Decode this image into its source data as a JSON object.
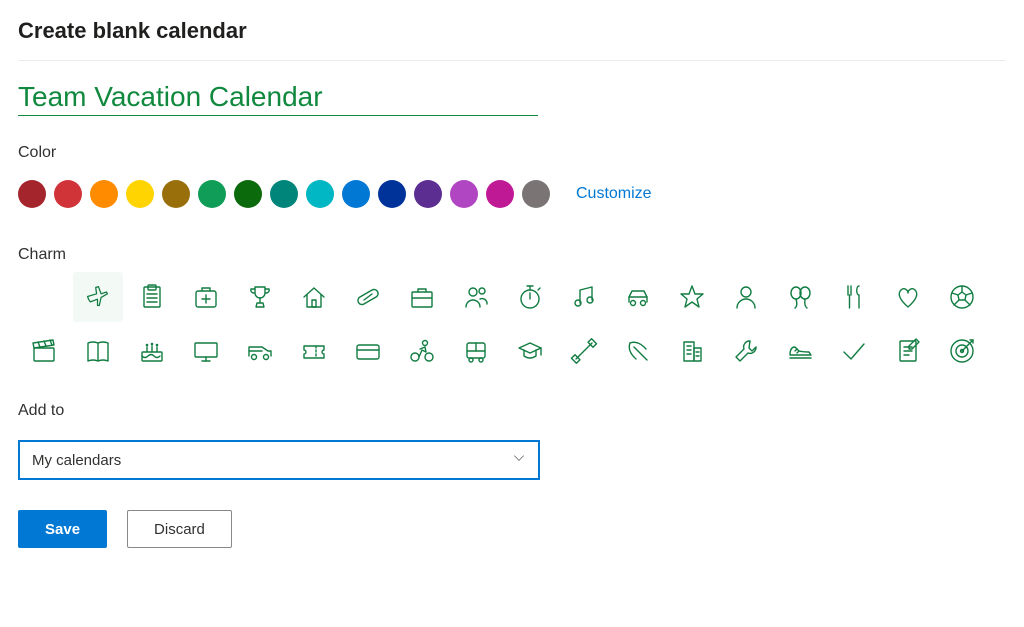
{
  "title": "Create blank calendar",
  "calendar_name": "Team Vacation Calendar",
  "labels": {
    "color": "Color",
    "charm": "Charm",
    "customize": "Customize",
    "add_to": "Add to"
  },
  "colors": [
    {
      "name": "dark-red",
      "hex": "#a4262c"
    },
    {
      "name": "red",
      "hex": "#d13438"
    },
    {
      "name": "orange",
      "hex": "#ff8c00"
    },
    {
      "name": "yellow",
      "hex": "#ffd400"
    },
    {
      "name": "brown",
      "hex": "#986f0b"
    },
    {
      "name": "green",
      "hex": "#0f9d58"
    },
    {
      "name": "dark-green",
      "hex": "#0b6a0b"
    },
    {
      "name": "teal",
      "hex": "#00857a"
    },
    {
      "name": "cyan",
      "hex": "#00b7c3"
    },
    {
      "name": "blue",
      "hex": "#0078d4"
    },
    {
      "name": "dark-blue",
      "hex": "#003399"
    },
    {
      "name": "purple",
      "hex": "#5c2e91"
    },
    {
      "name": "magenta",
      "hex": "#b146c2"
    },
    {
      "name": "pink",
      "hex": "#c01996"
    },
    {
      "name": "gray",
      "hex": "#7a7574"
    }
  ],
  "charms_row1": [
    "plane",
    "clipboard",
    "first-aid",
    "trophy",
    "home",
    "pill",
    "briefcase",
    "people",
    "stopwatch",
    "music",
    "car",
    "star",
    "person",
    "balloon",
    "cutlery",
    "heart",
    "soccer"
  ],
  "charms_row2": [
    "clapper",
    "book",
    "cake",
    "monitor",
    "van",
    "ticket",
    "card",
    "cycling",
    "bus",
    "graduation",
    "dumbbell",
    "pickaxe",
    "building",
    "wrench",
    "shoe",
    "check",
    "notebook",
    "target"
  ],
  "selected_charm": "plane",
  "add_to_selected": "My calendars",
  "buttons": {
    "save": "Save",
    "discard": "Discard"
  }
}
